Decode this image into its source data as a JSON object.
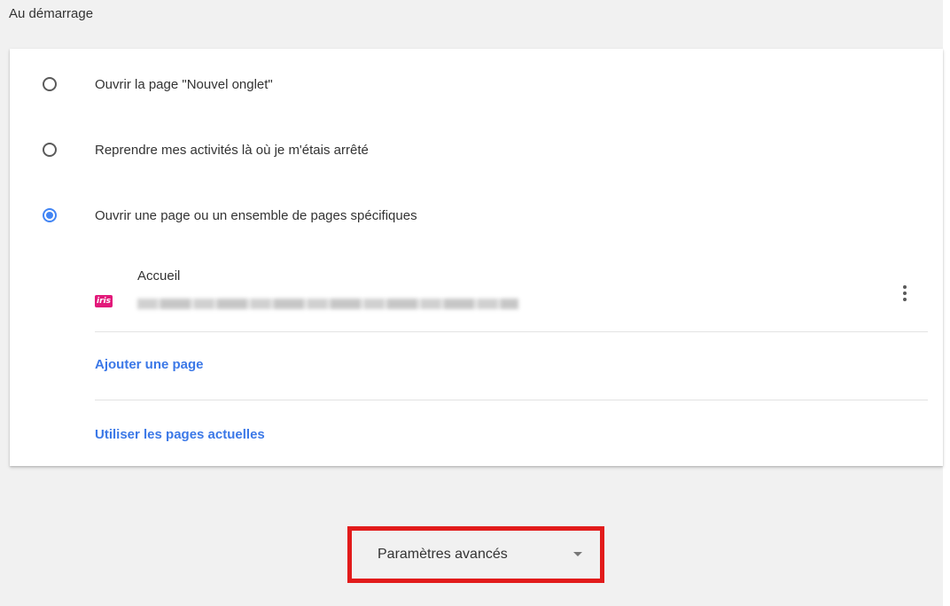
{
  "section": {
    "title": "Au démarrage"
  },
  "startup_options": [
    {
      "label": "Ouvrir la page \"Nouvel onglet\"",
      "checked": false
    },
    {
      "label": "Reprendre mes activités là où je m'étais arrêté",
      "checked": false
    },
    {
      "label": "Ouvrir une page ou un ensemble de pages spécifiques",
      "checked": true
    }
  ],
  "pages": [
    {
      "name": "Accueil",
      "url": "",
      "favicon": "iris-favicon",
      "favicon_color": "#e2197a"
    }
  ],
  "actions": {
    "add_page": "Ajouter une page",
    "use_current": "Utiliser les pages actuelles"
  },
  "advanced": {
    "label": "Paramètres avancés",
    "icon": "dropdown-arrow-icon",
    "highlight_color": "#e21b1b"
  },
  "colors": {
    "accent": "#4285f4",
    "link": "#3b78e7",
    "background": "#f1f1f1"
  }
}
